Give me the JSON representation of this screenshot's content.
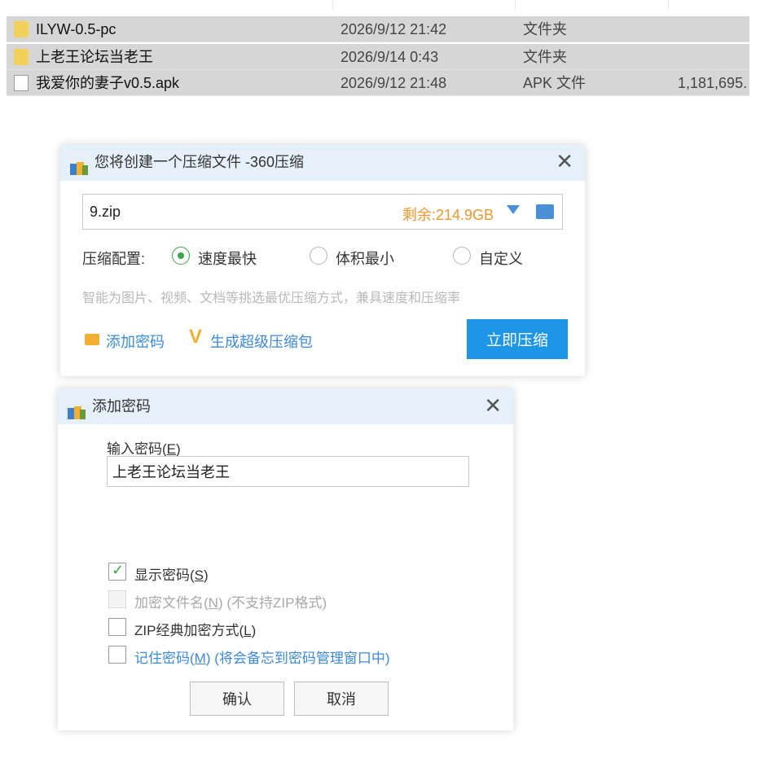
{
  "files": [
    {
      "name": "ILYW-0.5-pc",
      "date": "2026/9/12 21:42",
      "type": "文件夹",
      "size": "",
      "icon": "folder-icon"
    },
    {
      "name": "上老王论坛当老王",
      "date": "2026/9/14 0:43",
      "type": "文件夹",
      "size": "",
      "icon": "folder-icon"
    },
    {
      "name": "我爱你的妻子v0.5.apk",
      "date": "2026/9/12 21:48",
      "type": "APK 文件",
      "size": "1,181,695.",
      "icon": "file-icon"
    }
  ],
  "compress_dialog": {
    "title": "您将创建一个压缩文件 -360压缩",
    "close": "✕",
    "path_value": "9.zip",
    "free_space": "剩余:214.9GB",
    "config_label": "压缩配置:",
    "options": [
      {
        "label": "速度最快",
        "selected": true
      },
      {
        "label": "体积最小",
        "selected": false
      },
      {
        "label": "自定义",
        "selected": false
      }
    ],
    "hint": "智能为图片、视频、文档等挑选最优压缩方式，兼具速度和压缩率",
    "add_password": "添加密码",
    "super_pack": "生成超级压缩包",
    "compress_now": "立即压缩"
  },
  "password_dialog": {
    "title": "添加密码",
    "close": "✕",
    "input_label": "输入密码(",
    "input_label_key": "E",
    "input_label_end": ")",
    "password_value": "上老王论坛当老王",
    "checkboxes": [
      {
        "label": "显示密码(",
        "key": "S",
        "end": ")",
        "note": "",
        "checked": true,
        "disabled": false
      },
      {
        "label": "加密文件名(",
        "key": "N",
        "end": ")",
        "note": " (不支持ZIP格式)",
        "checked": false,
        "disabled": true
      },
      {
        "label": "ZIP经典加密方式(",
        "key": "L",
        "end": ")",
        "note": "",
        "checked": false,
        "disabled": false
      },
      {
        "label": "记住密码(",
        "key": "M",
        "end": ")",
        "note": " (将会备忘到密码管理窗口中)",
        "checked": false,
        "disabled": false
      }
    ],
    "ok": "确认",
    "cancel": "取消"
  },
  "colors": {
    "accent": "#1e96e8",
    "link": "#3b8ad8",
    "warn": "#f0962a",
    "check": "#3aa64c"
  }
}
